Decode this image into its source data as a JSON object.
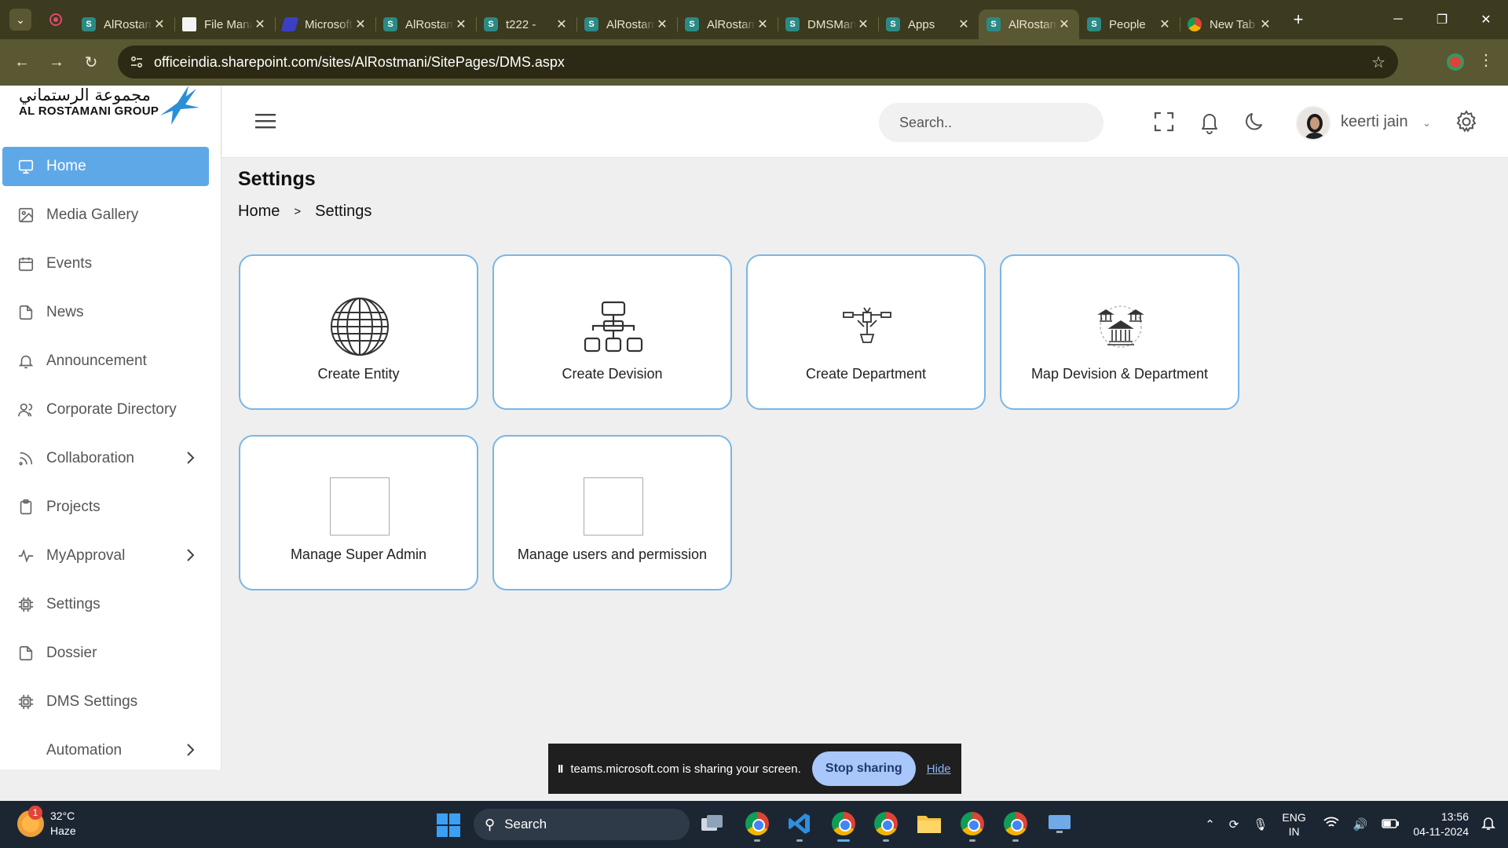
{
  "browser": {
    "tabs": [
      {
        "title": "AlRostamani",
        "icon": "sharepoint"
      },
      {
        "title": "File Manager",
        "icon": "doc"
      },
      {
        "title": "Microsoft",
        "icon": "copilot"
      },
      {
        "title": "AlRostamani",
        "icon": "sharepoint"
      },
      {
        "title": "t222 -",
        "icon": "sharepoint"
      },
      {
        "title": "AlRostamani",
        "icon": "sharepoint"
      },
      {
        "title": "AlRostamani",
        "icon": "sharepoint"
      },
      {
        "title": "DMSManager",
        "icon": "sharepoint"
      },
      {
        "title": "Apps",
        "icon": "sharepoint"
      },
      {
        "title": "AlRostamani",
        "icon": "sharepoint",
        "active": true
      },
      {
        "title": "People",
        "icon": "sharepoint"
      },
      {
        "title": "New Tab",
        "icon": "chrome"
      }
    ],
    "url": "officeindia.sharepoint.com/sites/AlRostmani/SitePages/DMS.aspx"
  },
  "logo": {
    "arabic": "مجموعة الرستماني",
    "english": "AL ROSTAMANI GROUP"
  },
  "sidebar": {
    "items": [
      {
        "label": "Home",
        "icon": "monitor-icon",
        "active": true
      },
      {
        "label": "Media Gallery",
        "icon": "image-icon"
      },
      {
        "label": "Events",
        "icon": "calendar-icon"
      },
      {
        "label": "News",
        "icon": "document-icon"
      },
      {
        "label": "Announcement",
        "icon": "bell-icon"
      },
      {
        "label": "Corporate Directory",
        "icon": "users-icon"
      },
      {
        "label": "Collaboration",
        "icon": "rss-icon",
        "has_children": true
      },
      {
        "label": "Projects",
        "icon": "clipboard-icon"
      },
      {
        "label": "MyApproval",
        "icon": "activity-icon",
        "has_children": true
      },
      {
        "label": "Settings",
        "icon": "cpu-icon"
      },
      {
        "label": "Dossier",
        "icon": "document-icon"
      },
      {
        "label": "DMS Settings",
        "icon": "cpu-icon"
      },
      {
        "label": "Automation",
        "icon": "",
        "has_children": true
      }
    ]
  },
  "topbar": {
    "search_placeholder": "Search..",
    "username": "keerti jain"
  },
  "page": {
    "title": "Settings",
    "breadcrumb": [
      {
        "label": "Home"
      },
      {
        "label": "Settings"
      }
    ],
    "breadcrumb_separator": ">"
  },
  "cards": [
    {
      "label": "Create Entity",
      "icon": "globe-icon"
    },
    {
      "label": "Create Devision",
      "icon": "hierarchy-icon"
    },
    {
      "label": "Create Department",
      "icon": "department-icon"
    },
    {
      "label": "Map Devision & Department",
      "icon": "bank-icon"
    },
    {
      "label": "Manage Super Admin",
      "icon": "image-placeholder"
    },
    {
      "label": "Manage users and permission",
      "icon": "image-placeholder"
    }
  ],
  "screen_share": {
    "pause_glyph": "II",
    "message": "teams.microsoft.com is sharing your screen.",
    "stop_label": "Stop sharing",
    "hide_label": "Hide"
  },
  "taskbar": {
    "weather_badge": "1",
    "temperature": "32°C",
    "condition": "Haze",
    "search_label": "Search",
    "lang_top": "ENG",
    "lang_bottom": "IN",
    "time": "13:56",
    "date": "04-11-2024"
  },
  "colors": {
    "accent": "#5fa8e8",
    "card_border": "#7ab6e6",
    "browser_frame": "#3c3a1f"
  }
}
